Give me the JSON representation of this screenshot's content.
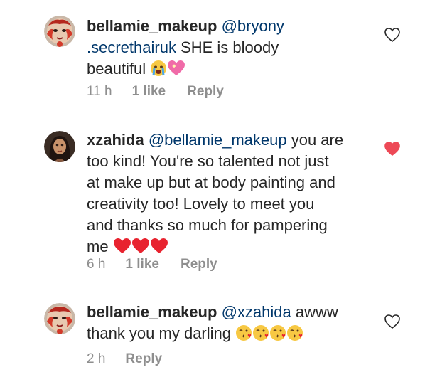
{
  "comments": [
    {
      "username": "bellamie_makeup",
      "mention": "@bryony .secrethairuk",
      "mention_line1": "@bryony",
      "mention_line2": ".secrethairuk",
      "text_rest": " SHE is bloody",
      "text_line3": "beautiful",
      "emojis": [
        "crying-face-emoji",
        "sparkling-heart-emoji"
      ],
      "time": "11 h",
      "likes": "1 like",
      "reply": "Reply",
      "liked": false
    },
    {
      "username": "xzahida",
      "mention": "@bellamie_makeup",
      "line1_rest": " you are",
      "line2": "too kind! You're so talented not just",
      "line3": "at make up but at body painting and",
      "line4": "creativity too! Lovely to meet you",
      "line5": "and thanks so much for pampering",
      "line6": "me",
      "emojis": [
        "red-heart-emoji",
        "red-heart-emoji",
        "red-heart-emoji"
      ],
      "time": "6 h",
      "likes": "1 like",
      "reply": "Reply",
      "liked": true
    },
    {
      "username": "bellamie_makeup",
      "mention": "@xzahida",
      "line1_rest": " awww",
      "line2": "thank you my darling",
      "emojis": [
        "kissing-face-emoji",
        "kissing-face-emoji",
        "kissing-face-emoji",
        "kissing-face-emoji"
      ],
      "time": "2 h",
      "reply": "Reply",
      "liked": false
    }
  ],
  "colors": {
    "text": "#262626",
    "secondary": "#8e8e8e",
    "mention": "#00376b",
    "like_red": "#ed4956"
  }
}
